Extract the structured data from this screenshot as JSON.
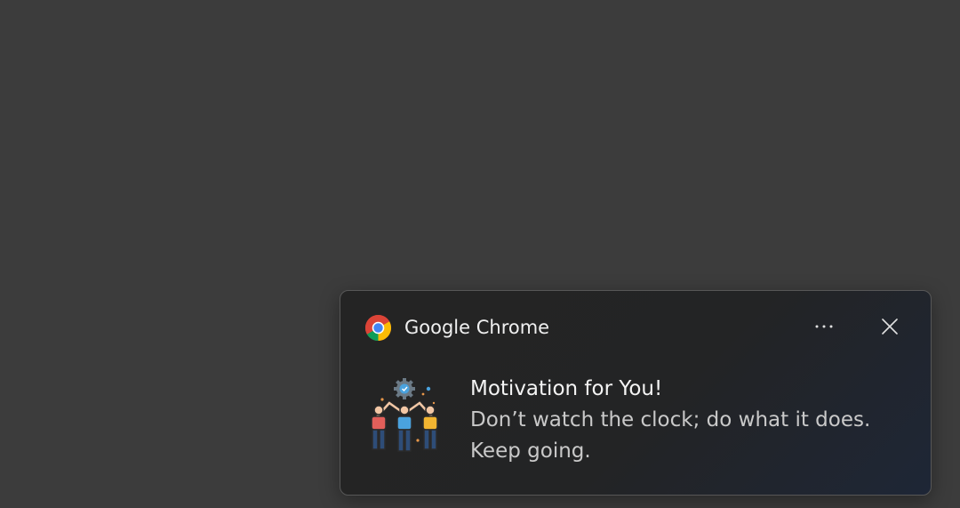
{
  "desktop": {
    "background": "#3c3c3c"
  },
  "notification": {
    "app_name": "Google Chrome",
    "app_icon": "chrome-logo-icon",
    "more_options_icon": "more-horizontal-icon",
    "close_icon": "close-icon",
    "image": "team-celebration-illustration",
    "title": "Motivation for You!",
    "body_line_1": "Don’t watch the clock; do what it does.",
    "body_line_2": "Keep going."
  }
}
